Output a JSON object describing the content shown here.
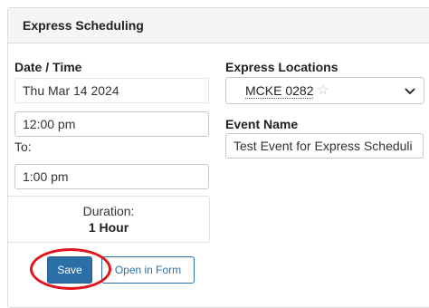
{
  "panel": {
    "title": "Express Scheduling"
  },
  "date_time": {
    "label": "Date / Time",
    "date_value": "Thu Mar 14 2024",
    "start_time": "12:00 pm",
    "to_label": "To:",
    "end_time": "1:00 pm"
  },
  "duration": {
    "label": "Duration:",
    "value": "1 Hour"
  },
  "location": {
    "label": "Express Locations",
    "selected": "MCKE 0282",
    "star_icon": "star-outline-icon",
    "dropdown_icon": "chevron-down-icon"
  },
  "event": {
    "label": "Event Name",
    "value": "Test Event for Express Scheduli"
  },
  "actions": {
    "save_label": "Save",
    "open_in_form_label": "Open in Form"
  },
  "colors": {
    "primary": "#2b6ea8",
    "annotation_circle": "#e0141a",
    "header_bg": "#f5f5f5"
  }
}
